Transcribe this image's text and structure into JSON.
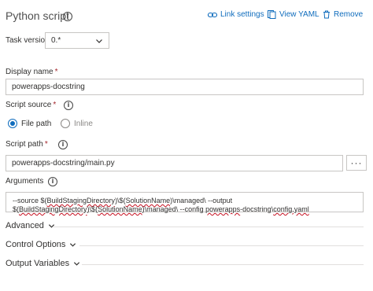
{
  "header": {
    "title": "Python script",
    "links": {
      "link_settings": "Link settings",
      "view_yaml": "View YAML",
      "remove": "Remove"
    }
  },
  "task_version": {
    "label": "Task version",
    "value": "0.*"
  },
  "display_name": {
    "label": "Display name",
    "required_marker": "*",
    "value": "powerapps-docstring"
  },
  "script_source": {
    "label": "Script source",
    "required_marker": "*",
    "options": [
      "File path",
      "Inline"
    ],
    "selected": "File path"
  },
  "script_path": {
    "label": "Script path",
    "required_marker": "*",
    "value": "powerapps-docstring/main.py",
    "browse_label": "···"
  },
  "arguments": {
    "label": "Arguments",
    "line1": {
      "a": "--source $(",
      "b": "BuildStagingDirectory",
      "c": ")\\$(",
      "d": "SolutionName",
      "e": ")\\managed\\ --output"
    },
    "line2": {
      "a": "$(",
      "b": "BuildStagingDirectory",
      "c": ")\\$(",
      "d": "SolutionName",
      "e": ")\\managed\\ --config ",
      "f": "powerapps",
      "g": "-docstring\\",
      "h": "config.yaml"
    }
  },
  "sections": {
    "advanced": "Advanced",
    "control_options": "Control Options",
    "output_variables": "Output Variables"
  },
  "colors": {
    "accent": "#0f6cbd",
    "required": "#a4262c",
    "border": "#c8c6c4"
  },
  "icons": [
    "info-icon",
    "link-icon",
    "view-yaml-icon",
    "trash-icon",
    "chevron-down-icon"
  ]
}
